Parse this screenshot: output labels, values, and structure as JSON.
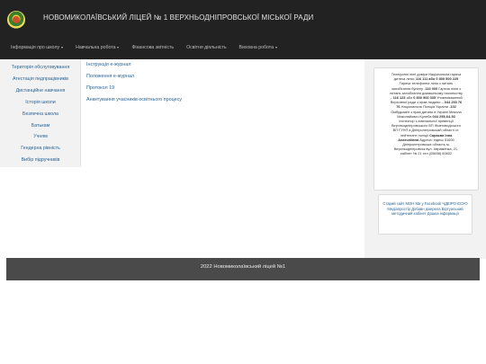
{
  "header": {
    "title": "НОВОМИКОЛАЇВСЬКИЙ ЛІЦЕЙ № 1 ВЕРХНЬОДНІПРОВСЬКОЇ МІСЬКОЇ РАДИ"
  },
  "nav": {
    "items": [
      {
        "label": "Інформація про школу",
        "dropdown": true
      },
      {
        "label": "Навчальна робота",
        "dropdown": true
      },
      {
        "label": "Фінансова звітність",
        "dropdown": false
      },
      {
        "label": "Освітня діяльність",
        "dropdown": false
      },
      {
        "label": "Виховна робота",
        "dropdown": true
      }
    ]
  },
  "sidebar": {
    "items": [
      {
        "label": "Територія обслуговування"
      },
      {
        "label": "Атестація педпрацівників"
      },
      {
        "label": "Дистанційне навчання"
      },
      {
        "label": "Історія школи"
      },
      {
        "label": "Безпечна школа"
      },
      {
        "label": "Батькам"
      },
      {
        "label": "Учням"
      },
      {
        "label": "Гендерна рівність"
      },
      {
        "label": "Вибір підручників"
      }
    ]
  },
  "main": {
    "links": [
      {
        "label": "Інструкція е-журнал"
      },
      {
        "label": "Положення е-журнал"
      },
      {
        "label": "Протокол 19"
      },
      {
        "label": "Анкетування учасників освітнього процесу"
      }
    ]
  },
  "panel": {
    "p1": "Телефонні лінії довіри Національна гаряча",
    "p2": "дитяча лінія:",
    "p2b": "116 111 або 0 800 500 225",
    "p3": "Гаряча телефонна лінія з питань",
    "p4": "запобігання булінгу -",
    "p4b": "116 000",
    "p4c": "Гаряча лінія з",
    "p5": "питань запобігання домашньому насильству",
    "p6": "–",
    "p6b": "116 123",
    "p6c": "або",
    "p6d": "0 800 500 335",
    "p6e": "Уповноважений",
    "p7": "Верховної ради з прав людини –",
    "p7b": "044 253 76",
    "p8b": "76",
    "p8": "Національна Поліція України -",
    "p8c": "102",
    "p9": "Омбудсмен з прав дитини в Україні Микола",
    "p10": "Миколайович Кулеба",
    "p10b": "044 255-64-50",
    "p11": "Інспектор з ювенальної превенції",
    "p12": "Верхньодніпровського ВП Жовтоводського",
    "p13": "ВП ГУНП в Дніпропетровській області ст.",
    "p14": "лейтенант поліції",
    "p14b": "Сараєва Інна",
    "p15b": "Анатоліївна",
    "p15": "Адреса: індекс 51600",
    "p16": "Дніпропетровська область м.",
    "p17": "Верхньодніпровськ вул. Авраменка, 21,",
    "p18": "кабінет № 21 тел (05658) 60602",
    "links2": "Старий сайт МОН Ми у Facebook ЧДЕІРО ЄСУО Медіапростір Добавн джерела Віртуальний методичний кабінет Дошка інформації"
  },
  "footer": {
    "text": "2022 Новомиколаївський ліцей №1"
  }
}
